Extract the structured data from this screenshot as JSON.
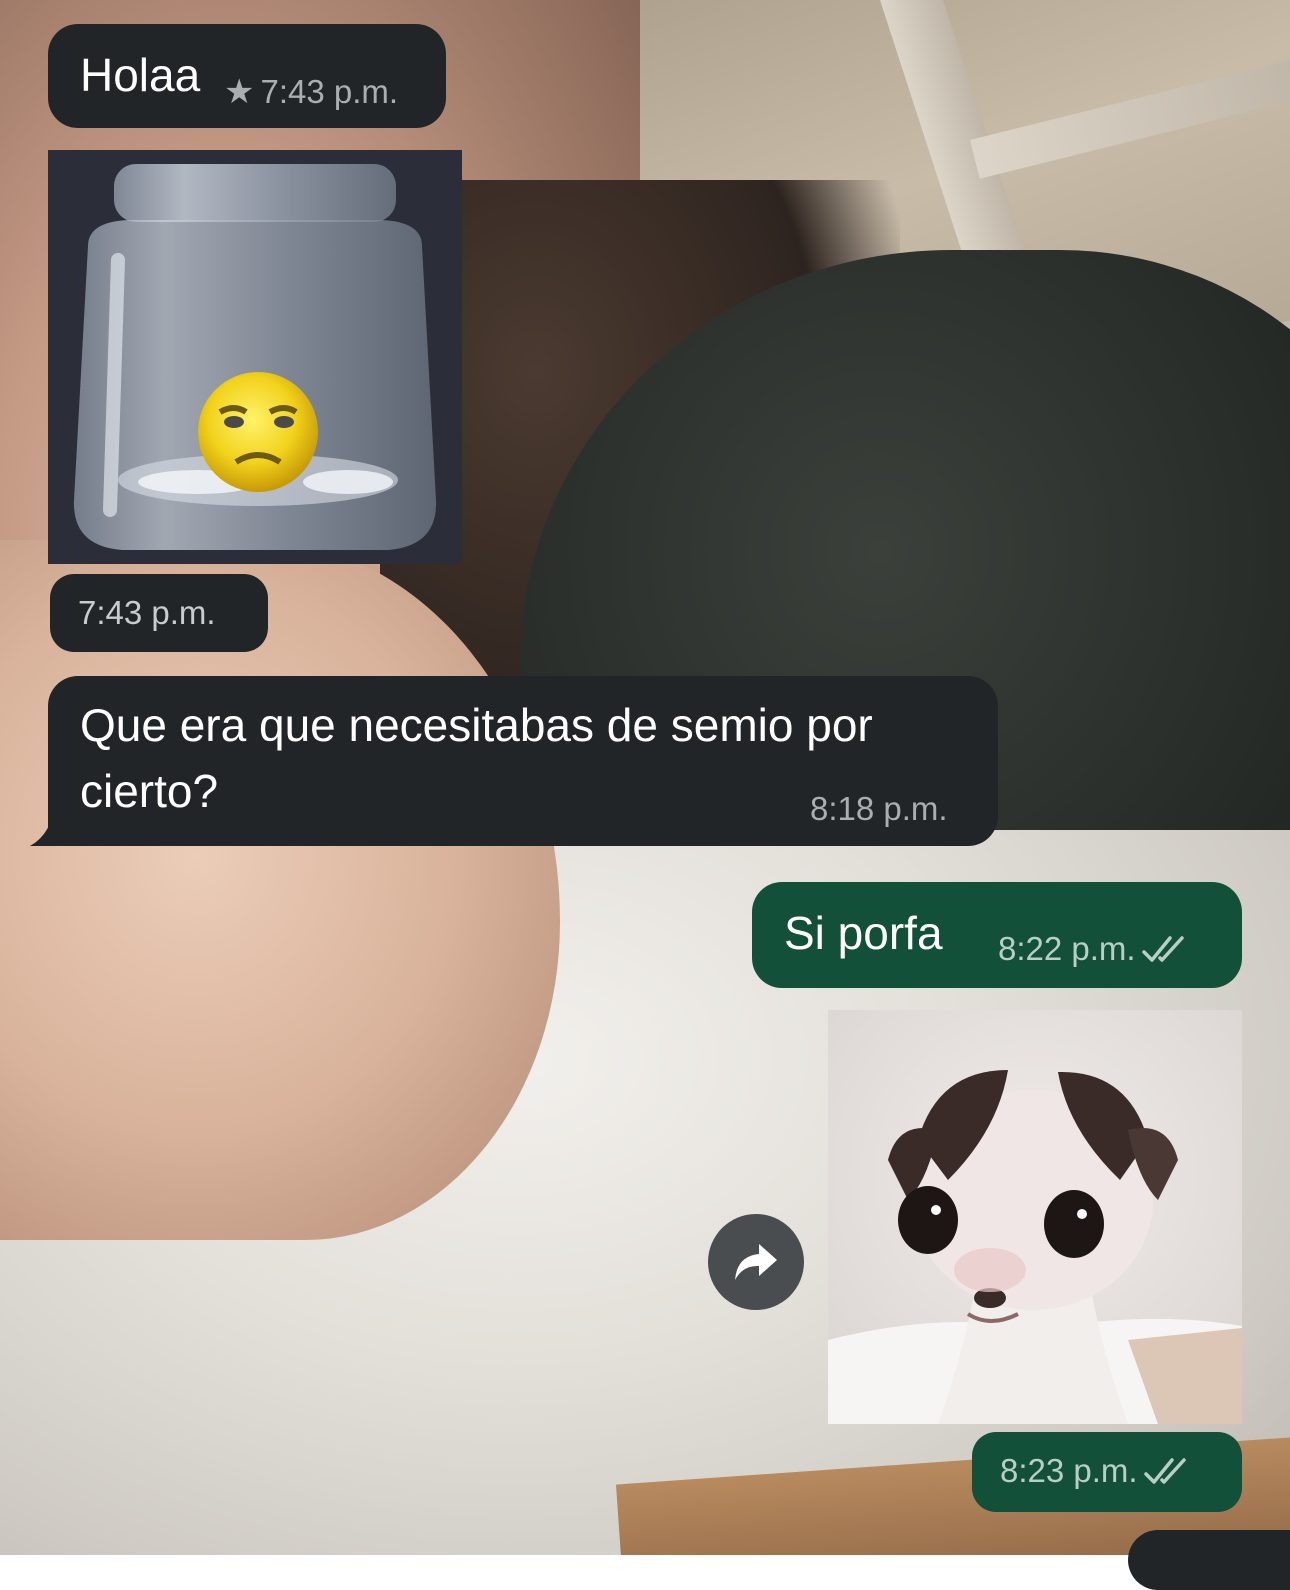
{
  "messages": [
    {
      "id": "m1",
      "direction": "incoming",
      "type": "text",
      "text": "Holaa",
      "starred": true,
      "star_glyph": "★",
      "time": "7:43 p.m."
    },
    {
      "id": "m2",
      "direction": "incoming",
      "type": "sticker",
      "sticker_icon": "jar-emoji-sticker",
      "time": "7:43 p.m."
    },
    {
      "id": "m3",
      "direction": "incoming",
      "type": "text",
      "text": "Que era que necesitabas de semio por cierto?",
      "time": "8:18 p.m."
    },
    {
      "id": "m4",
      "direction": "outgoing",
      "type": "text",
      "text": "Si porfa",
      "time": "8:22 p.m.",
      "status": "read"
    },
    {
      "id": "m5",
      "direction": "outgoing",
      "type": "sticker",
      "sticker_icon": "chihuahua-sticker",
      "time": "8:23 p.m.",
      "status": "read"
    }
  ],
  "actions": {
    "forward_icon": "forward-arrow-icon"
  },
  "colors": {
    "incoming_bubble": "#222528",
    "outgoing_bubble": "#13503a",
    "timestamp": "#a8aeb2",
    "read_ticks": "#b7cfc5"
  }
}
